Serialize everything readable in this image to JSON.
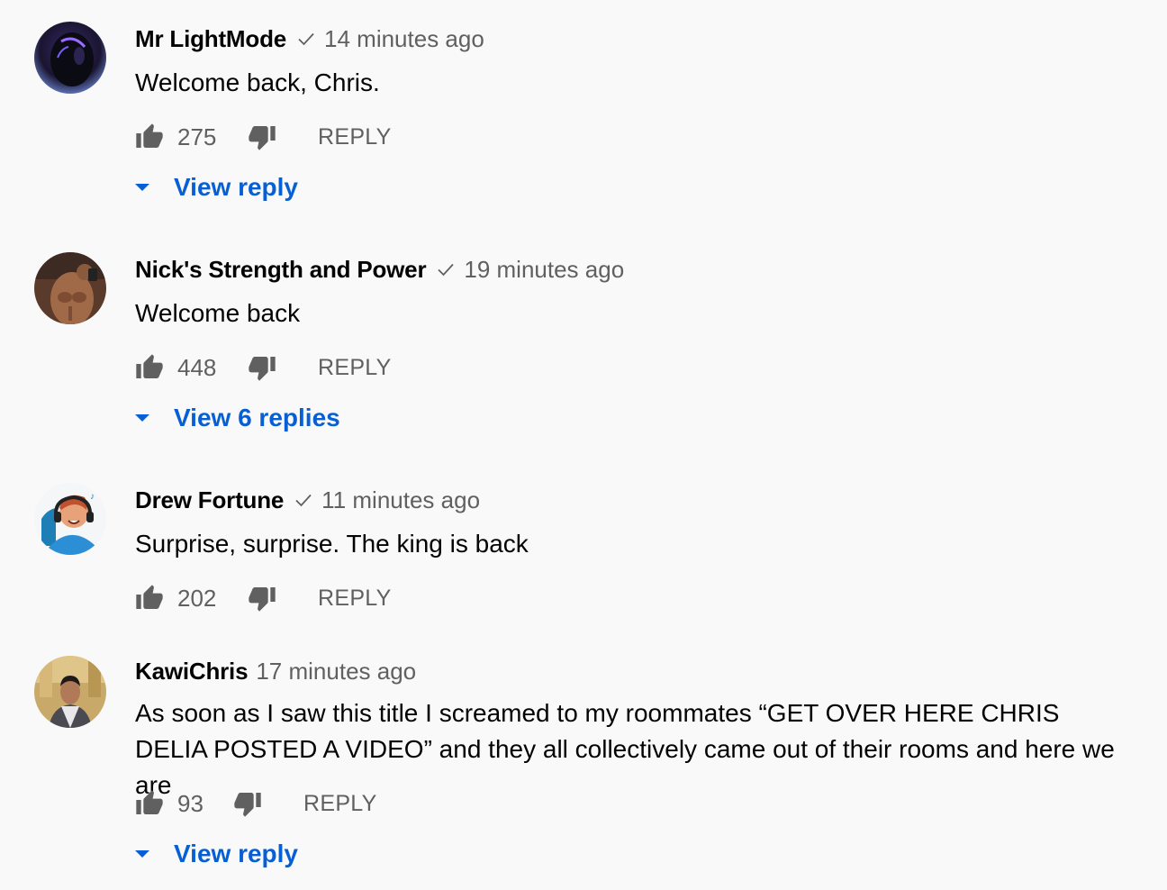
{
  "colors": {
    "background": "#f9f9f9",
    "author": "#030303",
    "meta": "#606060",
    "link": "#065fd4"
  },
  "icons": {
    "like": "thumbs-up-icon",
    "dislike": "thumbs-down-icon",
    "verified": "check-icon",
    "expand": "caret-down-icon"
  },
  "comments": [
    {
      "author": "Mr LightMode",
      "verified": true,
      "time": "14 minutes ago",
      "text": "Welcome back, Chris.",
      "likes": "275",
      "reply_label": "REPLY",
      "view_replies": "View reply"
    },
    {
      "author": "Nick's Strength and Power",
      "verified": true,
      "time": "19 minutes ago",
      "text": "Welcome back",
      "likes": "448",
      "reply_label": "REPLY",
      "view_replies": "View 6 replies"
    },
    {
      "author": "Drew Fortune",
      "verified": true,
      "time": "11 minutes ago",
      "text": "Surprise, surprise. The king is back",
      "likes": "202",
      "reply_label": "REPLY",
      "view_replies": ""
    },
    {
      "author": "KawiChris",
      "verified": false,
      "time": "17 minutes ago",
      "text": "As soon as I saw this title I screamed to my roommates “GET OVER HERE CHRIS DELIA POSTED A VIDEO” and they all collectively came out of their rooms and here we are",
      "likes": "93",
      "reply_label": "REPLY",
      "view_replies": "View reply"
    }
  ]
}
